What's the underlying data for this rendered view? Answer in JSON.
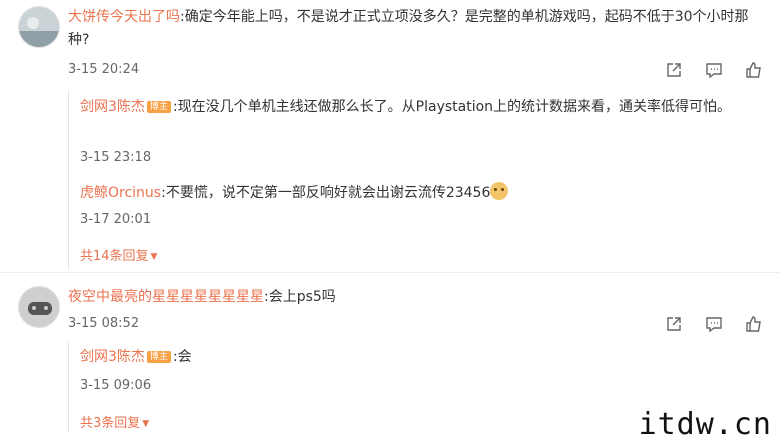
{
  "comments": [
    {
      "user": "大饼传今天出了吗",
      "text": ":确定今年能上吗，不是说才正式立项没多久？是完整的单机游戏吗，起码不低于30个小时那种?",
      "time": "3-15 20:24",
      "replies": [
        {
          "user": "剑网3陈杰",
          "badge": "博主",
          "text": ":现在没几个单机主线还做那么长了。从Playstation上的统计数据来看，通关率低得可怕。",
          "time": "3-15 23:18"
        },
        {
          "user": "虎鲸Orcinus",
          "badge": "",
          "text": ":不要慌，说不定第一部反响好就会出谢云流传23456",
          "time": "3-17 20:01"
        }
      ],
      "more": "共14条回复"
    },
    {
      "user": "夜空中最亮的星星星星星星星星",
      "text": ":会上ps5吗",
      "time": "3-15 08:52",
      "replies": [
        {
          "user": "剑网3陈杰",
          "badge": "博主",
          "text": ":会",
          "time": "3-15 09:06"
        }
      ],
      "more": "共3条回复"
    }
  ],
  "icons": [
    "share-icon",
    "comment-icon",
    "like-icon"
  ],
  "watermark": "itdw.cn",
  "colors": {
    "username": "#eb7350",
    "badge": "#f7a044",
    "text": "#333333",
    "time": "#666666"
  }
}
